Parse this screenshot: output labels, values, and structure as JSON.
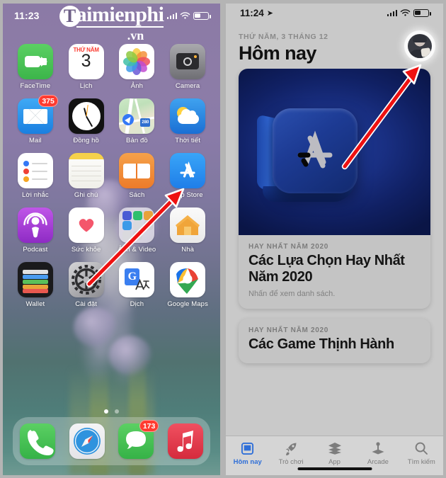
{
  "watermark": {
    "initial": "T",
    "name": "aimienphi",
    "tld": ".vn"
  },
  "left_phone": {
    "status": {
      "time": "11:23"
    },
    "apps": [
      {
        "label": "FaceTime",
        "icon": "facetime-icon",
        "badge": null
      },
      {
        "label": "Lịch",
        "icon": "calendar-icon",
        "badge": null,
        "cal_weekday": "THỨ NĂM",
        "cal_day": "3"
      },
      {
        "label": "Ảnh",
        "icon": "photos-icon",
        "badge": null
      },
      {
        "label": "Camera",
        "icon": "camera-icon",
        "badge": null
      },
      {
        "label": "Mail",
        "icon": "mail-icon",
        "badge": "375"
      },
      {
        "label": "Đồng hồ",
        "icon": "clock-icon",
        "badge": null
      },
      {
        "label": "Bản đồ",
        "icon": "maps-icon",
        "badge": null,
        "shield": "280"
      },
      {
        "label": "Thời tiết",
        "icon": "weather-icon",
        "badge": null
      },
      {
        "label": "Lời nhắc",
        "icon": "reminders-icon",
        "badge": null
      },
      {
        "label": "Ghi chú",
        "icon": "notes-icon",
        "badge": null
      },
      {
        "label": "Sách",
        "icon": "books-icon",
        "badge": null
      },
      {
        "label": "App Store",
        "icon": "app-store-icon",
        "badge": null
      },
      {
        "label": "Podcast",
        "icon": "podcasts-icon",
        "badge": null
      },
      {
        "label": "Sức khỏe",
        "icon": "health-icon",
        "badge": null
      },
      {
        "label": "Ảnh & Video",
        "icon": "folder-icon",
        "badge": null
      },
      {
        "label": "Nhà",
        "icon": "home-icon",
        "badge": null
      },
      {
        "label": "Wallet",
        "icon": "wallet-icon",
        "badge": null
      },
      {
        "label": "Cài đặt",
        "icon": "settings-gear-icon",
        "badge": null
      },
      {
        "label": "Dịch",
        "icon": "translate-icon",
        "badge": null
      },
      {
        "label": "Google Maps",
        "icon": "google-maps-icon",
        "badge": null
      }
    ],
    "page_dots": {
      "count": 2,
      "active_index": 0
    },
    "dock": [
      {
        "label": "Phone",
        "icon": "phone-icon",
        "badge": null
      },
      {
        "label": "Safari",
        "icon": "safari-compass-icon",
        "badge": null
      },
      {
        "label": "Messages",
        "icon": "messages-bubble-icon",
        "badge": "173"
      },
      {
        "label": "Music",
        "icon": "music-note-icon",
        "badge": null
      }
    ]
  },
  "right_phone": {
    "status": {
      "time": "11:24"
    },
    "header": {
      "date": "THỨ NĂM, 3 THÁNG 12",
      "title": "Hôm nay",
      "avatar": "profile-avatar"
    },
    "cards": [
      {
        "eyebrow": "HAY NHẤT NĂM 2020",
        "title": "Các Lựa Chọn Hay Nhất Năm 2020",
        "subtitle": "Nhấn để xem danh sách.",
        "hero": "app-store-3d-cube"
      },
      {
        "eyebrow": "HAY NHẤT NĂM 2020",
        "title": "Các Game Thịnh Hành",
        "subtitle": "",
        "hero": null
      }
    ],
    "tabs": [
      {
        "label": "Hôm nay",
        "icon": "today-card-icon",
        "active": true
      },
      {
        "label": "Trò chơi",
        "icon": "rocket-icon",
        "active": false
      },
      {
        "label": "App",
        "icon": "stack-layers-icon",
        "active": false
      },
      {
        "label": "Arcade",
        "icon": "arcade-joystick-icon",
        "active": false
      },
      {
        "label": "Tìm kiếm",
        "icon": "search-magnifier-icon",
        "active": false
      }
    ]
  },
  "annotations": {
    "arrows": [
      {
        "name": "arrow-to-app-store",
        "color": "#ee1111",
        "from": "settings-icon",
        "to": "app-store-icon"
      },
      {
        "name": "arrow-to-profile-avatar",
        "color": "#ee1111",
        "from": "hero-card",
        "to": "profile-avatar"
      }
    ]
  },
  "colors": {
    "accent_blue": "#2f6fd8",
    "badge_red": "#ff3b30",
    "arrow_red": "#ee1111"
  }
}
